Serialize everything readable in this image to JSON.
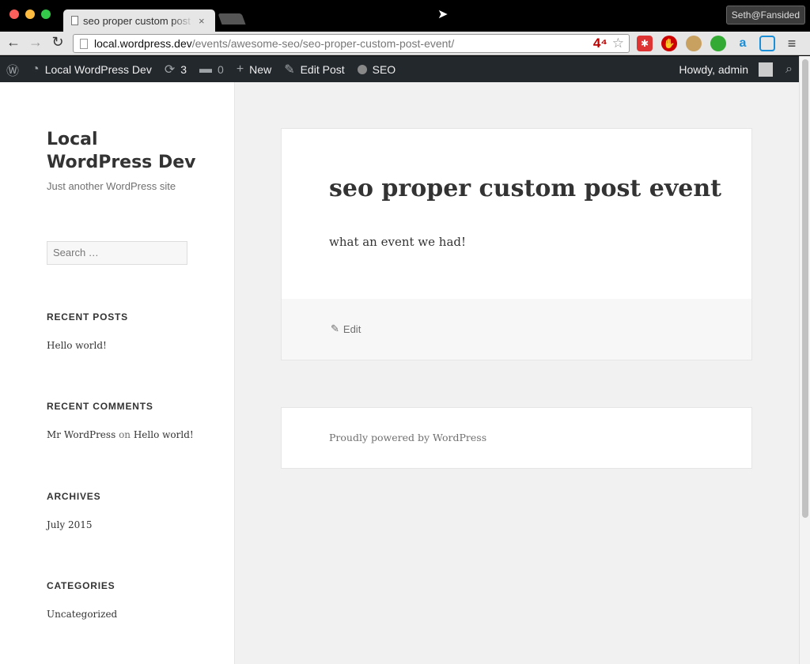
{
  "browser": {
    "tab_title": "seo proper custom post event",
    "tab_close": "×",
    "profile": "Seth@Fansided",
    "url_host": "local.wordpress.dev",
    "url_path": "/events/awesome-seo/seo-proper-custom-post-event/",
    "ext_badge": "4⁴",
    "icons": {
      "back": "←",
      "forward": "→",
      "reload": "↻",
      "star": "☆",
      "menu": "≡"
    }
  },
  "admin_bar": {
    "wp_logo": "Ⓦ",
    "site_name": "Local WordPress Dev",
    "updates_count": "3",
    "comments_count": "0",
    "new_label": "New",
    "edit_post_label": "Edit Post",
    "seo_label": "SEO",
    "howdy": "Howdy, admin",
    "colors": {
      "background": "#23282d",
      "text": "#eeeeee"
    }
  },
  "sidebar": {
    "site_title": "Local WordPress Dev",
    "tagline": "Just another WordPress site",
    "search_placeholder": "Search …",
    "widgets": {
      "recent_posts": {
        "title": "RECENT POSTS",
        "items": [
          "Hello world!"
        ]
      },
      "recent_comments": {
        "title": "RECENT COMMENTS",
        "author": "Mr WordPress",
        "on": "on",
        "post": "Hello world!"
      },
      "archives": {
        "title": "ARCHIVES",
        "items": [
          "July 2015"
        ]
      },
      "categories": {
        "title": "CATEGORIES",
        "items": [
          "Uncategorized"
        ]
      }
    }
  },
  "post": {
    "title": "seo proper custom post event",
    "body": "what an event we had!",
    "edit_label": "Edit"
  },
  "footer": {
    "powered_by": "Proudly powered by WordPress"
  }
}
